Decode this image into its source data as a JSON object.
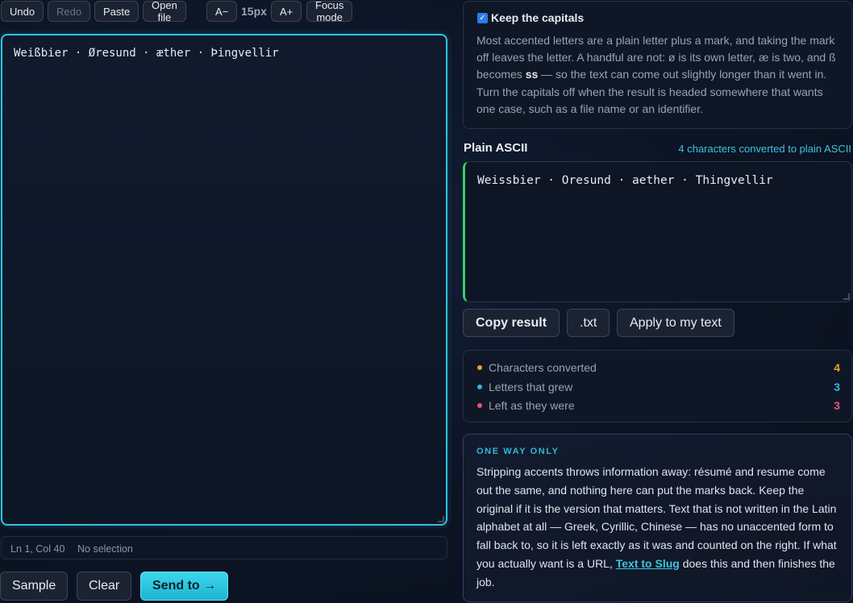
{
  "toolbar": {
    "undo": "Undo",
    "redo": "Redo",
    "paste": "Paste",
    "open_file": "Open file",
    "font_decrease": "A−",
    "font_size": "15px",
    "font_increase": "A+",
    "focus_mode": "Focus mode"
  },
  "editor": {
    "text": "Weißbier · Øresund · æther · Þingvellir"
  },
  "status": {
    "position": "Ln 1, Col 40",
    "selection": "No selection"
  },
  "actions": {
    "sample": "Sample",
    "clear": "Clear",
    "send_to": "Send to →"
  },
  "options": {
    "keep_capitals_label": "Keep the capitals",
    "keep_capitals_checked": true,
    "desc_part1": "Most accented letters are a plain letter plus a mark, and taking the mark off leaves the letter. A handful are not: ø is its own letter, æ is two, and ß becomes ",
    "desc_bold": "ss",
    "desc_part2": " — so the text can come out slightly longer than it went in. Turn the capitals off when the result is headed somewhere that wants one case, such as a file name or an identifier."
  },
  "output": {
    "title": "Plain ASCII",
    "count_label": "4 characters converted to plain ASCII",
    "text": "Weissbier · Oresund · aether · Thingvellir",
    "copy": "Copy result",
    "txt": ".txt",
    "apply": "Apply to my text"
  },
  "stats": [
    {
      "label": "Characters converted",
      "value": "4",
      "color": "#e8a12a"
    },
    {
      "label": "Letters that grew",
      "value": "3",
      "color": "#2fb9d4"
    },
    {
      "label": "Left as they were",
      "value": "3",
      "color": "#e8556f"
    }
  ],
  "note": {
    "heading": "ONE WAY ONLY",
    "body": "Stripping accents throws information away: résumé and resume come out the same, and nothing here can put the marks back. Keep the original if it is the version that matters. Text that is not written in the Latin alphabet at all — Greek, Cyrillic, Chinese — has no unaccented form to fall back to, so it is left exactly as it was and counted on the right. If what you actually want is a URL, ",
    "link": "Text to Slug",
    "tail": " does this and then finishes the job."
  },
  "colors": {
    "accent": "#2fc3dc",
    "output_border": "#2fd26a"
  }
}
